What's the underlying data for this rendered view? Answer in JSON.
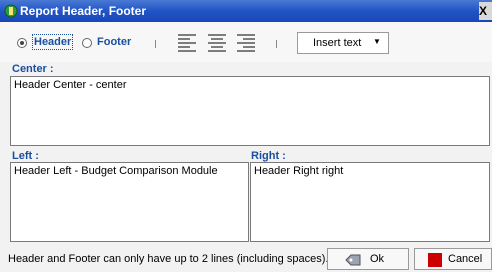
{
  "window": {
    "title": "Report Header, Footer",
    "close_glyph": "X"
  },
  "toolbar": {
    "radio_header": "Header",
    "radio_footer": "Footer",
    "selected": "Header",
    "insert_text_label": "Insert text",
    "align_icons": [
      "align-left-icon",
      "align-center-icon",
      "align-right-icon"
    ]
  },
  "center": {
    "label": "Center :",
    "value": "Header Center - center"
  },
  "left": {
    "label": "Left :",
    "value": "Header Left  - Budget Comparison Module"
  },
  "right": {
    "label": "Right :",
    "value": "Header Right right"
  },
  "footer": {
    "note": "Header and Footer can only have up to 2 lines (including spaces).",
    "ok_label": "Ok",
    "cancel_label": "Cancel"
  },
  "colors": {
    "title_bar": "#2154c6",
    "label_blue": "#1a4fa0",
    "cancel_red": "#cc0000"
  }
}
